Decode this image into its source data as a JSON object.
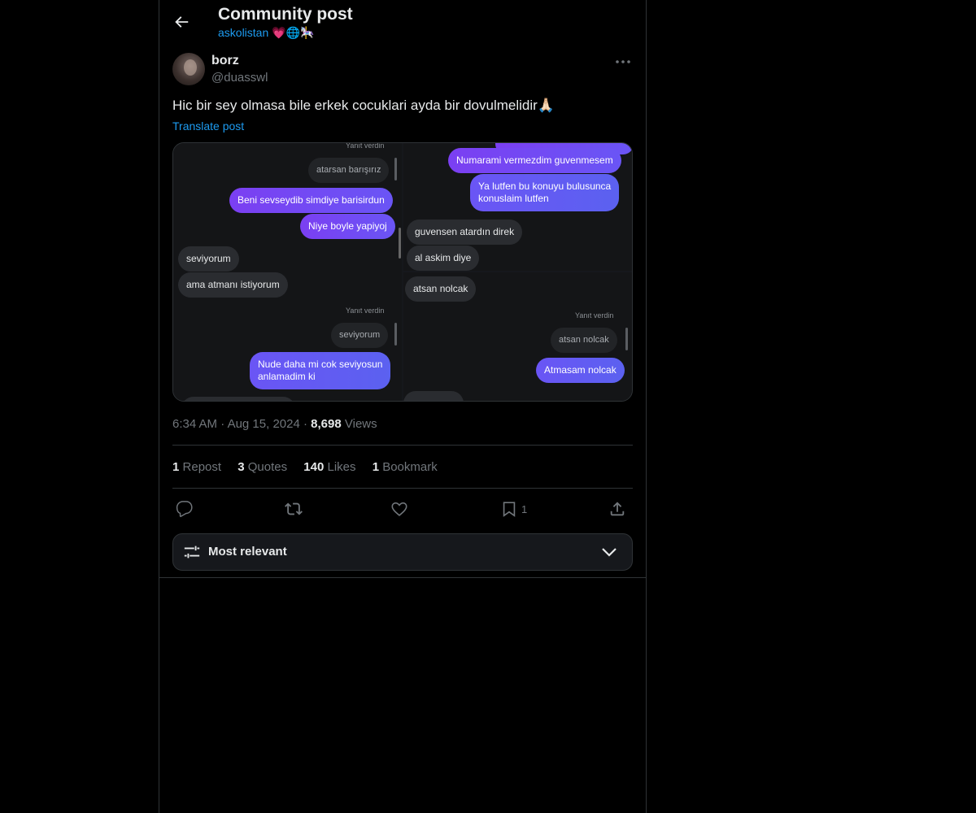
{
  "header": {
    "title": "Community post",
    "community": "askolistan 💗🌐🎠"
  },
  "post": {
    "author_name": "borz",
    "author_handle": "@duasswl",
    "text": "Hic bir sey olmasa bile erkek cocuklari ayda bir dovulmelidir🙏🏻",
    "translate_label": "Translate post",
    "time": "6:34 AM",
    "date": "Aug 15, 2024",
    "views_count": "8,698",
    "views_label": "Views"
  },
  "stats": {
    "reposts_count": "1",
    "reposts_label": "Repost",
    "quotes_count": "3",
    "quotes_label": "Quotes",
    "likes_count": "140",
    "likes_label": "Likes",
    "bookmarks_count": "1",
    "bookmarks_label": "Bookmark"
  },
  "actions": {
    "bookmark_count": "1"
  },
  "sort": {
    "label": "Most relevant"
  },
  "media": {
    "left": {
      "reply_label_1": "Yanıt verdin",
      "quote_1": "atarsan barışırız",
      "m1": "Beni sevseydib simdiye barisirdun",
      "m2": "Niye boyle yapiyoj",
      "m3": "seviyorum",
      "m4": "ama atmanı istiyorum",
      "reply_label_2": "Yanıt verdin",
      "quote_2": "seviyorum",
      "m5a": "Nude daha mi cok seviyosun",
      "m5b": "anlamadim ki"
    },
    "top_right": {
      "m1": "Numarami vermezdim guvenmesem",
      "m2a": "Ya lutfen bu konuyu bulusunca",
      "m2b": "konuslaim lutfen",
      "m3": "guvensen atardın direk",
      "m4": "al askim diye"
    },
    "bottom_right": {
      "m1": "atsan nolcak",
      "reply_label": "Yanıt verdin",
      "quote": "atsan nolcak",
      "m2": "Atmasam nolcak"
    }
  },
  "colors": {
    "accent": "#1d9bf0",
    "background": "#000000",
    "border": "#2f3336",
    "muted": "#71767b"
  },
  "icons": [
    "back-arrow-icon",
    "more-icon",
    "reply-icon",
    "repost-icon",
    "like-icon",
    "bookmark-icon",
    "share-icon",
    "sort-sliders-icon",
    "chevron-down-icon"
  ]
}
